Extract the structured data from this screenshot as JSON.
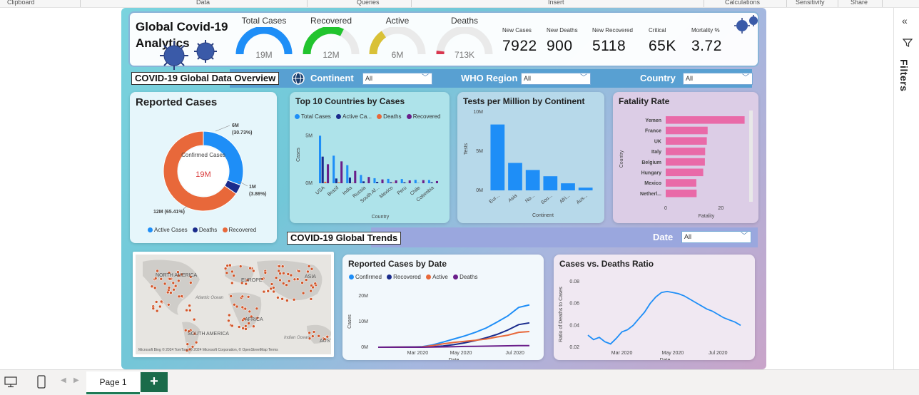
{
  "ribbon": {
    "groups": [
      "Clipboard",
      "Data",
      "Queries",
      "Insert",
      "Calculations",
      "Sensitivity",
      "Share"
    ]
  },
  "header": {
    "title_line1": "Global Covid-19",
    "title_line2": "Analytics",
    "gauges": [
      {
        "label": "Total Cases",
        "value": "19M",
        "color": "#1e8ef7",
        "fill": 1.0
      },
      {
        "label": "Recovered",
        "value": "12M",
        "color": "#22c42e",
        "fill": 0.65
      },
      {
        "label": "Active",
        "value": "6M",
        "color": "#d9c137",
        "fill": 0.31
      },
      {
        "label": "Deaths",
        "value": "713K",
        "color": "#d9364e",
        "fill": 0.04
      }
    ],
    "kpis": [
      {
        "label": "New Cases",
        "value": "7922"
      },
      {
        "label": "New Deaths",
        "value": "900"
      },
      {
        "label": "New Recovered",
        "value": "5118"
      },
      {
        "label": "Critical",
        "value": "65K"
      },
      {
        "label": "Mortality %",
        "value": "3.72"
      }
    ]
  },
  "overview": {
    "section_title": "COVID-19 Global Data Overview",
    "slicers": [
      {
        "label": "Continent",
        "value": "All"
      },
      {
        "label": "WHO Region",
        "value": "All"
      },
      {
        "label": "Country",
        "value": "All"
      }
    ]
  },
  "trends": {
    "section_title": "COVID-19 Global Trends",
    "date_label": "Date",
    "date_value": "All"
  },
  "reported_cases": {
    "title": "Reported Cases",
    "center_label": "Confirmed Cases",
    "center_value": "19M",
    "labels": {
      "active": "6M",
      "active_pct": "(30.73%)",
      "deaths": "1M",
      "deaths_pct": "(3.86%)",
      "recovered": "12M (65.41%)"
    },
    "legend": [
      "Active Cases",
      "Deaths",
      "Recovered"
    ]
  },
  "map": {
    "labels": [
      "NORTH AMERICA",
      "EUROPE",
      "ASIA",
      "Atlantic Ocean",
      "AFRICA",
      "SOUTH AMERICA",
      "Indian Ocean",
      "AUST"
    ],
    "credit": "Microsoft Bing   © 2024 TomTom, © 2024 Microsoft Corporation, © OpenStreetMap  Terms"
  },
  "colors": {
    "total": "#1e8ef7",
    "active_cases": "#1e8ef7",
    "active_ca": "#1a2b8c",
    "deaths_orange": "#e8683a",
    "recovered_purple": "#6a1e8a",
    "bar_blue": "#1e8ef7",
    "fatality_pink": "#e96aa8"
  },
  "chart_data": [
    {
      "id": "reported_cases_donut",
      "type": "pie",
      "title": "Reported Cases",
      "labels": [
        "Active Cases",
        "Deaths",
        "Recovered"
      ],
      "values": [
        30.73,
        3.86,
        65.41
      ]
    },
    {
      "id": "top10",
      "type": "bar",
      "title": "Top 10 Countries by Cases",
      "xlabel": "Country",
      "ylabel": "Cases",
      "ylim": [
        0,
        6
      ],
      "yticks": [
        "0M",
        "5M"
      ],
      "categories": [
        "USA",
        "Brazil",
        "India",
        "Russia",
        "South Af...",
        "Mexico",
        "Peru",
        "Chile",
        "Colombia"
      ],
      "series": [
        {
          "name": "Total Cases",
          "values": [
            5.0,
            2.9,
            1.9,
            0.87,
            0.53,
            0.46,
            0.44,
            0.36,
            0.34
          ]
        },
        {
          "name": "Active Ca...",
          "values": [
            2.8,
            0.5,
            0.6,
            0.2,
            0.15,
            0.1,
            0.1,
            0.02,
            0.1
          ]
        },
        {
          "name": "Deaths",
          "values": [
            0.16,
            0.1,
            0.04,
            0.015,
            0.01,
            0.05,
            0.02,
            0.01,
            0.01
          ]
        },
        {
          "name": "Recovered",
          "values": [
            2.0,
            2.3,
            1.3,
            0.66,
            0.4,
            0.3,
            0.3,
            0.33,
            0.23
          ]
        }
      ]
    },
    {
      "id": "tests",
      "type": "bar",
      "title": "Tests per Million by Continent",
      "xlabel": "Continent",
      "ylabel": "Tests",
      "ylim": [
        0,
        10
      ],
      "yticks": [
        "0M",
        "5M",
        "10M"
      ],
      "categories": [
        "Eur...",
        "Asia",
        "No...",
        "Sou...",
        "Afri...",
        "Aus..."
      ],
      "values": [
        8.4,
        3.5,
        2.6,
        1.8,
        0.9,
        0.35
      ]
    },
    {
      "id": "fatality",
      "type": "bar",
      "title": "Fatality Rate",
      "xlabel": "Fatality",
      "ylabel": "Country",
      "xlim": [
        0,
        30
      ],
      "xticks": [
        "0",
        "20"
      ],
      "categories": [
        "Yemen",
        "France",
        "UK",
        "Italy",
        "Belgium",
        "Hungary",
        "Mexico",
        "Netherl..."
      ],
      "values": [
        28.6,
        15.2,
        14.9,
        14.3,
        14.2,
        13.6,
        11.1,
        11.2
      ]
    },
    {
      "id": "reported_by_date",
      "type": "line",
      "title": "Reported Cases by Date",
      "xlabel": "Date",
      "ylabel": "Cases",
      "ylim": [
        0,
        20
      ],
      "yticks": [
        "0M",
        "10M",
        "20M"
      ],
      "xticks": [
        "Mar 2020",
        "May 2020",
        "Jul 2020"
      ],
      "x": [
        "Jan 22",
        "Feb 5",
        "Feb 19",
        "Mar 4",
        "Mar 18",
        "Apr 1",
        "Apr 15",
        "Apr 29",
        "May 13",
        "May 27",
        "Jun 10",
        "Jun 24",
        "Jul 8",
        "Jul 22",
        "Jul 27"
      ],
      "series": [
        {
          "name": "Confirmed",
          "values": [
            0.0,
            0.03,
            0.08,
            0.1,
            0.2,
            0.9,
            2.0,
            3.2,
            4.4,
            5.8,
            7.5,
            9.8,
            12.2,
            15.5,
            16.5
          ]
        },
        {
          "name": "Recovered",
          "values": [
            0.0,
            0.0,
            0.02,
            0.05,
            0.08,
            0.2,
            0.5,
            1.0,
            1.7,
            2.6,
            3.7,
            5.0,
            6.7,
            8.8,
            9.5
          ]
        },
        {
          "name": "Active",
          "values": [
            0.0,
            0.02,
            0.05,
            0.04,
            0.1,
            0.6,
            1.3,
            1.9,
            2.3,
            2.7,
            3.2,
            4.0,
            4.7,
            5.8,
            6.1
          ]
        },
        {
          "name": "Deaths",
          "values": [
            0.0,
            0.0,
            0.0,
            0.0,
            0.01,
            0.05,
            0.13,
            0.23,
            0.3,
            0.36,
            0.42,
            0.5,
            0.55,
            0.62,
            0.65
          ]
        }
      ]
    },
    {
      "id": "ratio",
      "type": "line",
      "title": "Cases vs. Deaths Ratio",
      "xlabel": "Date",
      "ylabel": "Ratio of Deaths to Cases",
      "ylim": [
        0.02,
        0.08
      ],
      "yticks": [
        "0.02",
        "0.04",
        "0.06",
        "0.08"
      ],
      "xticks": [
        "Mar 2020",
        "May 2020",
        "Jul 2020"
      ],
      "x": [
        "Jan 22",
        "Jan 29",
        "Feb 5",
        "Feb 12",
        "Feb 19",
        "Feb 26",
        "Mar 4",
        "Mar 11",
        "Mar 18",
        "Mar 25",
        "Apr 1",
        "Apr 8",
        "Apr 15",
        "Apr 22",
        "Apr 29",
        "May 6",
        "May 13",
        "May 20",
        "May 27",
        "Jun 3",
        "Jun 10",
        "Jun 17",
        "Jun 24",
        "Jul 1",
        "Jul 8",
        "Jul 15",
        "Jul 22",
        "Jul 27"
      ],
      "values": [
        0.031,
        0.027,
        0.029,
        0.025,
        0.023,
        0.028,
        0.034,
        0.036,
        0.04,
        0.046,
        0.052,
        0.06,
        0.066,
        0.07,
        0.071,
        0.07,
        0.069,
        0.067,
        0.064,
        0.061,
        0.058,
        0.055,
        0.053,
        0.05,
        0.047,
        0.045,
        0.043,
        0.04
      ]
    }
  ],
  "tabs": {
    "page_label": "Page 1",
    "add_label": "+"
  },
  "filter_pane": {
    "label": "Filters"
  }
}
